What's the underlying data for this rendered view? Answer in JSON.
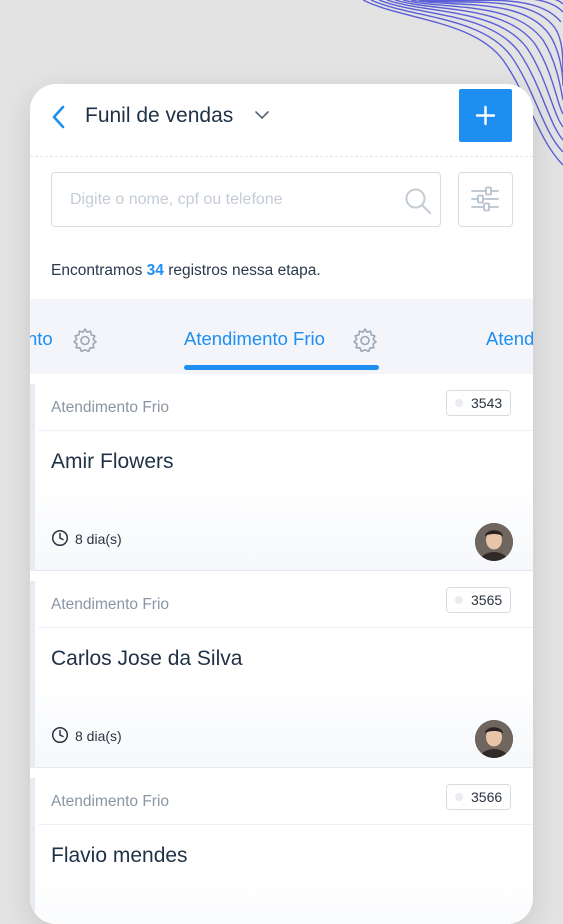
{
  "header": {
    "title": "Funil de vendas"
  },
  "search": {
    "placeholder": "Digite o nome, cpf ou telefone"
  },
  "summary": {
    "prefix": "Encontramos",
    "count": "34",
    "suffix": "registros nessa etapa."
  },
  "tabs": [
    {
      "label": "nto",
      "active": false
    },
    {
      "label": "Atendimento Frio",
      "active": true
    },
    {
      "label": "Atend",
      "active": false
    }
  ],
  "cards": [
    {
      "stage": "Atendimento Frio",
      "id": "3543",
      "name": "Amir Flowers",
      "time": "8 dia(s)"
    },
    {
      "stage": "Atendimento Frio",
      "id": "3565",
      "name": "Carlos Jose da Silva",
      "time": "8 dia(s)"
    },
    {
      "stage": "Atendimento Frio",
      "id": "3566",
      "name": "Flavio mendes",
      "time": ""
    }
  ],
  "colors": {
    "accent": "#1e8ff1",
    "text": "#1f3147",
    "muted": "#8a96a3",
    "tabs_bg": "#f3f5fa"
  },
  "icons": [
    "chevron-left-icon",
    "chevron-down-icon",
    "plus-icon",
    "search-icon",
    "sliders-icon",
    "gear-icon",
    "clock-icon",
    "avatar"
  ]
}
